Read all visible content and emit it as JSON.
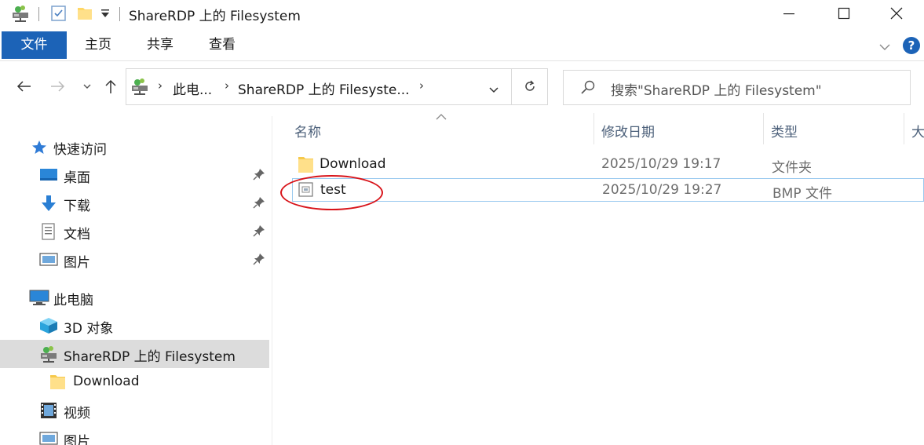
{
  "window": {
    "title": "ShareRDP 上的 Filesystem"
  },
  "ribbon": {
    "tabs": [
      "文件",
      "主页",
      "共享",
      "查看"
    ]
  },
  "address": {
    "crumbs": [
      "此电...",
      "ShareRDP 上的 Filesyste..."
    ]
  },
  "search": {
    "placeholder": "搜索\"ShareRDP 上的 Filesystem\""
  },
  "sidebar": {
    "quick_access": "快速访问",
    "quick_items": [
      "桌面",
      "下载",
      "文档",
      "图片"
    ],
    "this_pc": "此电脑",
    "pc_items": [
      "3D 对象",
      "ShareRDP 上的 Filesystem",
      "Download",
      "视频",
      "图片"
    ]
  },
  "columns": {
    "name": "名称",
    "modified": "修改日期",
    "type": "类型",
    "size": "大"
  },
  "files": [
    {
      "name": "Download",
      "modified": "2025/10/29 19:17",
      "type": "文件夹",
      "icon": "folder-icon"
    },
    {
      "name": "test",
      "modified": "2025/10/29 19:27",
      "type": "BMP 文件",
      "icon": "bmp-file-icon"
    }
  ],
  "colors": {
    "accent": "#1c63b7",
    "selection_border": "#99c9ef",
    "annotation": "#d8141a"
  }
}
